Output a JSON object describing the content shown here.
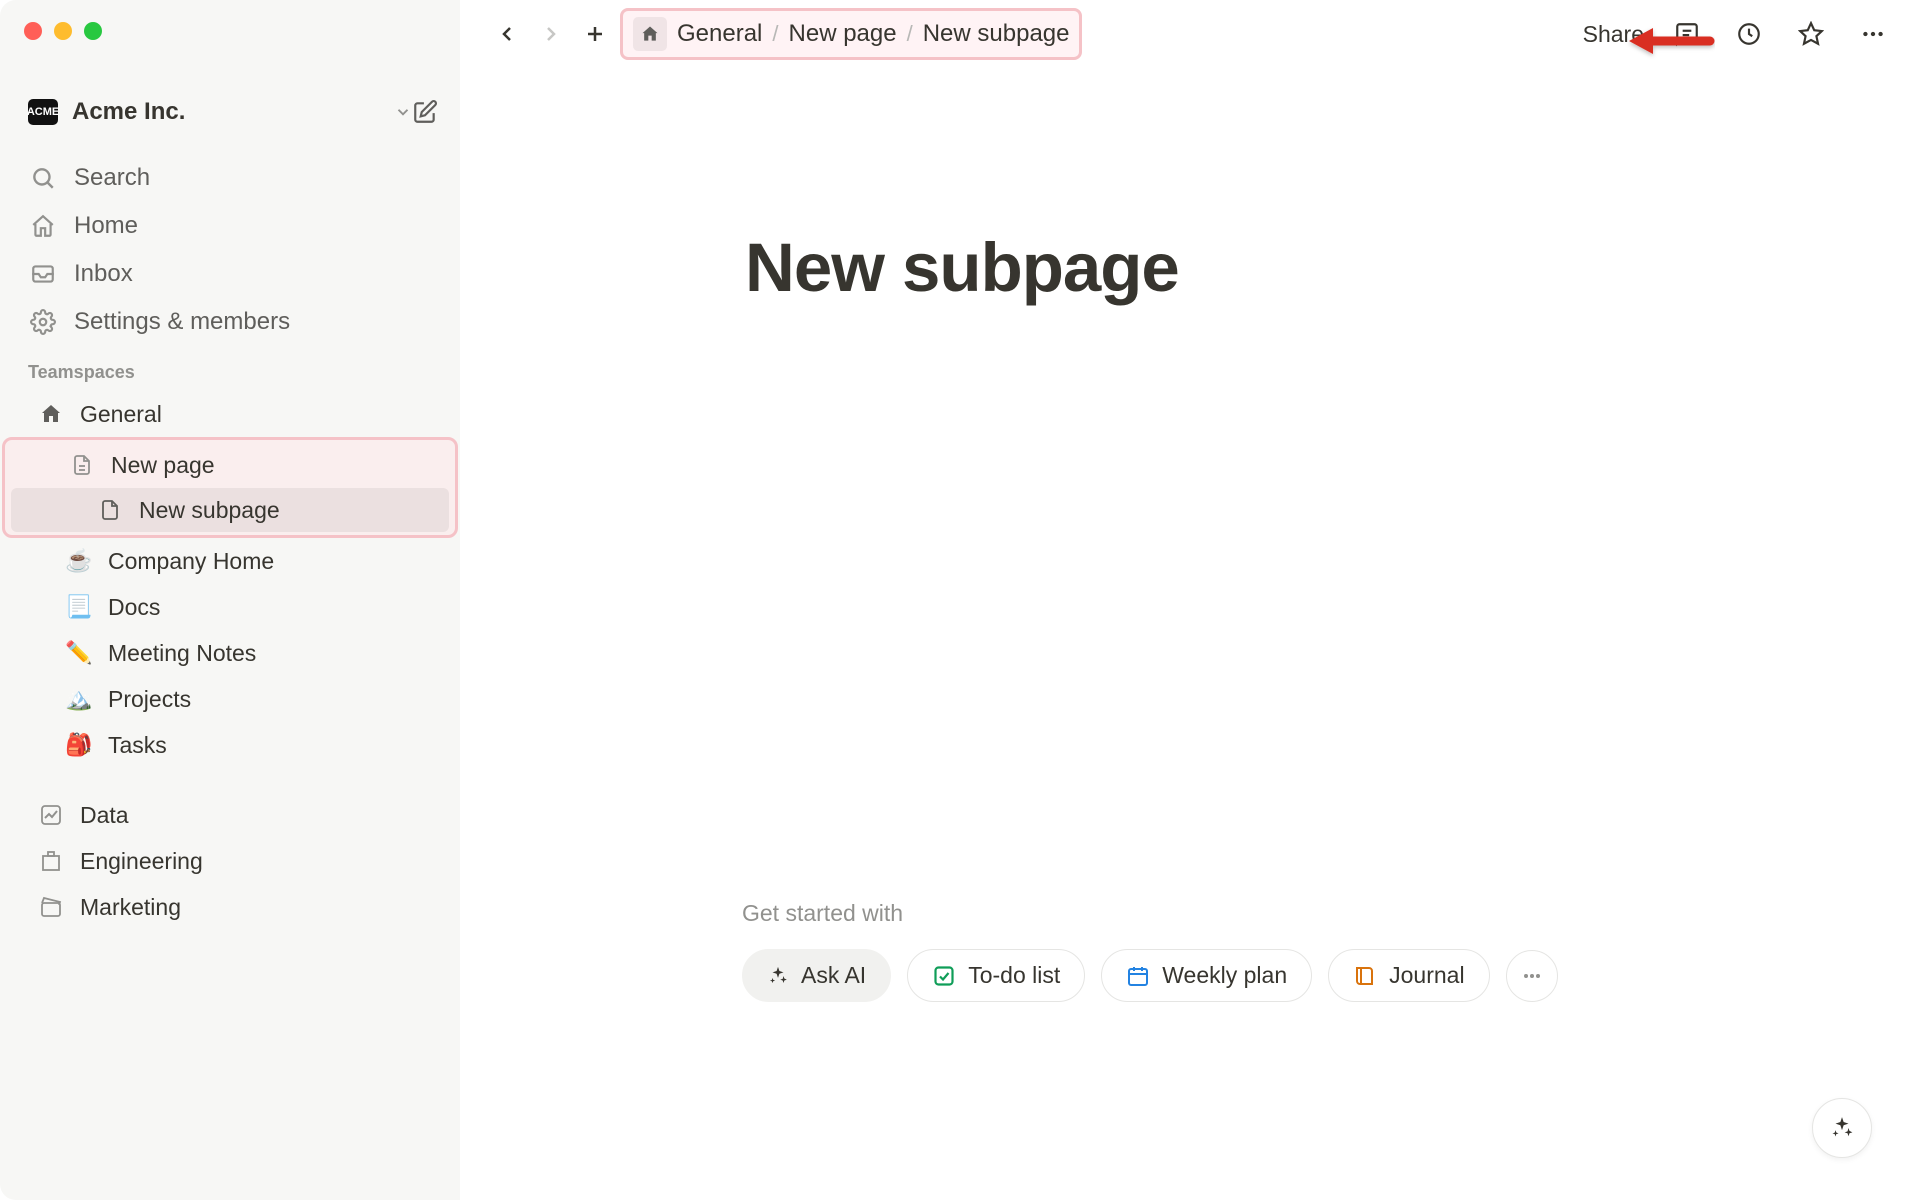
{
  "workspace": {
    "name": "Acme Inc.",
    "icon_text": "ACME"
  },
  "sidebar": {
    "nav": [
      {
        "label": "Search",
        "icon": "search"
      },
      {
        "label": "Home",
        "icon": "home"
      },
      {
        "label": "Inbox",
        "icon": "inbox"
      },
      {
        "label": "Settings & members",
        "icon": "gear"
      }
    ],
    "section_label": "Teamspaces",
    "tree": [
      {
        "label": "General",
        "icon": "house",
        "depth": 0
      },
      {
        "label": "New page",
        "icon": "page",
        "depth": 1,
        "highlighted": true
      },
      {
        "label": "New subpage",
        "icon": "page",
        "depth": 2,
        "highlighted": true,
        "selected": true
      },
      {
        "label": "Company Home",
        "icon": "☕",
        "depth": 1
      },
      {
        "label": "Docs",
        "icon": "📃",
        "depth": 1
      },
      {
        "label": "Meeting Notes",
        "icon": "✏️",
        "depth": 1
      },
      {
        "label": "Projects",
        "icon": "🏔️",
        "depth": 1
      },
      {
        "label": "Tasks",
        "icon": "🎒",
        "depth": 1
      }
    ],
    "bottom": [
      {
        "label": "Data",
        "icon": "chart"
      },
      {
        "label": "Engineering",
        "icon": "building"
      },
      {
        "label": "Marketing",
        "icon": "clapboard"
      }
    ]
  },
  "topbar": {
    "share": "Share"
  },
  "breadcrumb": {
    "items": [
      "General",
      "New page",
      "New subpage"
    ]
  },
  "page": {
    "title": "New subpage"
  },
  "starter": {
    "label": "Get started with",
    "chips": [
      {
        "label": "Ask AI",
        "icon": "sparkle",
        "primary": true
      },
      {
        "label": "To-do list",
        "icon": "checkbox",
        "color": "#0f9d58"
      },
      {
        "label": "Weekly plan",
        "icon": "calendar",
        "color": "#2383e2"
      },
      {
        "label": "Journal",
        "icon": "book",
        "color": "#d9730d"
      }
    ]
  }
}
